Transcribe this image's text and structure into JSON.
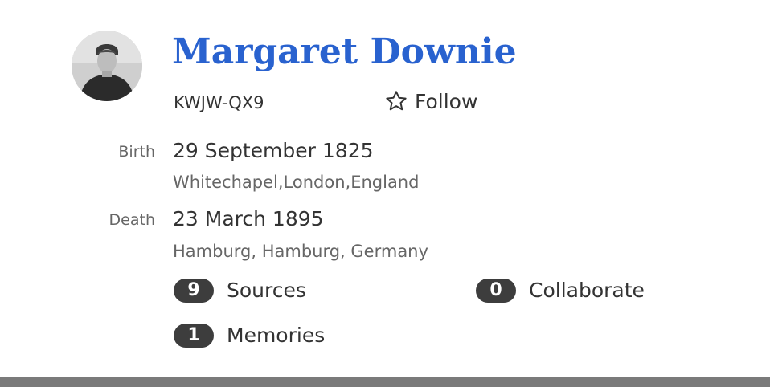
{
  "colors": {
    "name_link": "#2962cf",
    "badge_bg": "#3d3d3d",
    "bottom_bar": "#7a7a7a"
  },
  "person": {
    "name": "Margaret Downie",
    "pid": "KWJW-QX9",
    "follow_label": "Follow",
    "follow_icon": "star-outline-icon"
  },
  "vitals": {
    "birth": {
      "label": "Birth",
      "date": "29 September 1825",
      "place": "Whitechapel,London,England"
    },
    "death": {
      "label": "Death",
      "date": "23 March 1895",
      "place": "Hamburg, Hamburg, Germany"
    }
  },
  "counts": {
    "sources": {
      "count": "9",
      "label": "Sources"
    },
    "collaborate": {
      "count": "0",
      "label": "Collaborate"
    },
    "memories": {
      "count": "1",
      "label": "Memories"
    }
  }
}
